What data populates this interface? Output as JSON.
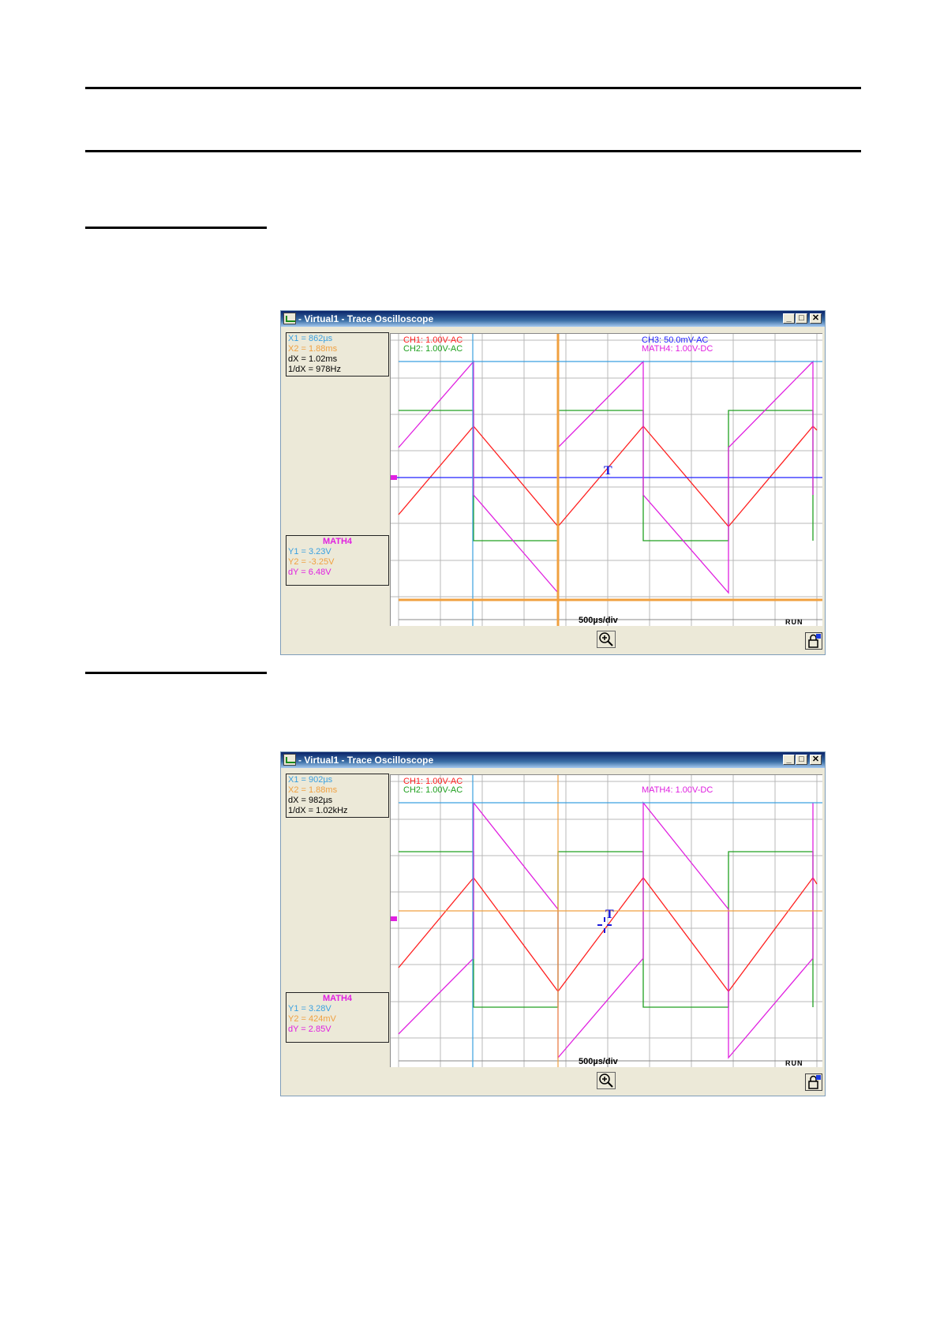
{
  "doc": {},
  "windows": [
    {
      "title": "- Virtual1 - Trace Oscilloscope",
      "buttons": {
        "minimize": "_",
        "maximize": "□",
        "close": "✕"
      },
      "cursor_box": [
        {
          "text": "X1 = 862µs",
          "color": "#3aa0e0"
        },
        {
          "text": "X2 = 1.88ms",
          "color": "#f0a040"
        },
        {
          "text": "dX = 1.02ms",
          "color": "#000000"
        },
        {
          "text": "1/dX = 978Hz",
          "color": "#000000"
        }
      ],
      "math_box": {
        "header": "MATH4",
        "rows": [
          {
            "text": "Y1 = 3.23V",
            "color": "#3aa0e0"
          },
          {
            "text": "Y2 = -3.25V",
            "color": "#f0a040"
          },
          {
            "text": "dY = 6.48V",
            "color": "#e020e0"
          }
        ]
      },
      "channel_labels": {
        "left": [
          {
            "text": "CH1: 1.00V-AC",
            "color": "#ff2020"
          },
          {
            "text": "CH2: 1.00V-AC",
            "color": "#20a020"
          }
        ],
        "right": [
          {
            "text": "CH3: 50.0mV-AC",
            "color": "#2020ff"
          },
          {
            "text": "MATH4: 1.00V-DC",
            "color": "#e020e0"
          }
        ]
      },
      "timebase": "500µs/div",
      "run_status": "RUN",
      "trigger_marker": "T",
      "icons": {
        "zoom": "zoom-in-icon",
        "lock": "lock-icon"
      },
      "chart_data": {
        "type": "line",
        "xlabel": "500µs/div",
        "grid": true,
        "series": [
          {
            "name": "CH1",
            "shape": "triangle",
            "period_ms": 2.0
          },
          {
            "name": "CH2",
            "shape": "square",
            "period_ms": 2.0
          },
          {
            "name": "CH3",
            "shape": "flat"
          },
          {
            "name": "MATH4",
            "shape": "sawtooth-rising",
            "period_ms": 2.0
          }
        ],
        "cursors": {
          "X1": "862µs",
          "X2": "1.88ms",
          "Y1": "3.23V",
          "Y2": "-3.25V"
        }
      }
    },
    {
      "title": "- Virtual1 - Trace Oscilloscope",
      "buttons": {
        "minimize": "_",
        "maximize": "□",
        "close": "✕"
      },
      "cursor_box": [
        {
          "text": "X1 = 902µs",
          "color": "#3aa0e0"
        },
        {
          "text": "X2 = 1.88ms",
          "color": "#f0a040"
        },
        {
          "text": "dX = 982µs",
          "color": "#000000"
        },
        {
          "text": "1/dX = 1.02kHz",
          "color": "#000000"
        }
      ],
      "math_box": {
        "header": "MATH4",
        "rows": [
          {
            "text": "Y1 = 3.28V",
            "color": "#3aa0e0"
          },
          {
            "text": "Y2 = 424mV",
            "color": "#f0a040"
          },
          {
            "text": "dY = 2.85V",
            "color": "#e020e0"
          }
        ]
      },
      "channel_labels": {
        "left": [
          {
            "text": "CH1: 1.00V-AC",
            "color": "#ff2020"
          },
          {
            "text": "CH2: 1.00V-AC",
            "color": "#20a020"
          }
        ],
        "right": [
          {
            "text": "",
            "color": "#2020ff"
          },
          {
            "text": "MATH4: 1.00V-DC",
            "color": "#e020e0"
          }
        ]
      },
      "timebase": "500µs/div",
      "run_status": "RUN",
      "trigger_marker": "T",
      "icons": {
        "zoom": "zoom-in-icon",
        "lock": "lock-icon"
      },
      "chart_data": {
        "type": "line",
        "xlabel": "500µs/div",
        "grid": true,
        "series": [
          {
            "name": "CH1",
            "shape": "triangle",
            "period_ms": 2.0
          },
          {
            "name": "CH2",
            "shape": "square",
            "period_ms": 2.0
          },
          {
            "name": "MATH4",
            "shape": "sawtooth-falling",
            "period_ms": 2.0
          }
        ],
        "cursors": {
          "X1": "902µs",
          "X2": "1.88ms",
          "Y1": "3.28V",
          "Y2": "424mV"
        }
      }
    }
  ]
}
